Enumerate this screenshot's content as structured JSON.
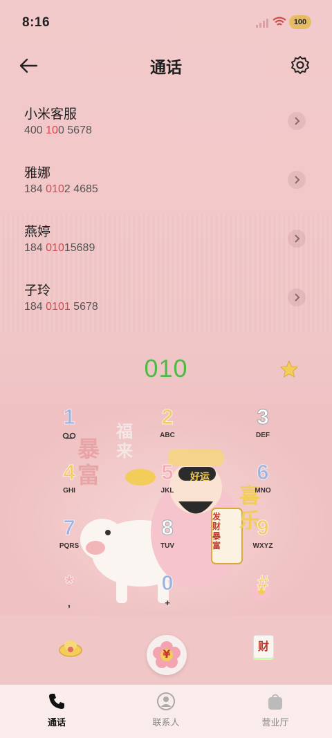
{
  "status": {
    "time": "8:16",
    "battery": "100"
  },
  "header": {
    "title": "通话"
  },
  "recent": [
    {
      "name": "小米客服",
      "num_pre": "400 ",
      "num_hl": "10",
      "num_post": "0 5678"
    },
    {
      "name": "雅娜",
      "num_pre": "184 ",
      "num_hl": "010",
      "num_post": "2 4685"
    },
    {
      "name": "燕婷",
      "num_pre": "184 ",
      "num_hl": "010",
      "num_post": "15689"
    },
    {
      "name": "子玲",
      "num_pre": "184 ",
      "num_hl": "0101",
      "num_post": " 5678"
    }
  ],
  "dialer": {
    "entered": "010",
    "keys": [
      {
        "num": "1",
        "letters": "",
        "color": "#9db1e0"
      },
      {
        "num": "2",
        "letters": "ABC",
        "color": "#f2cc6a"
      },
      {
        "num": "3",
        "letters": "DEF",
        "color": "#ffffff"
      },
      {
        "num": "4",
        "letters": "GHI",
        "color": "#f2cc6a"
      },
      {
        "num": "5",
        "letters": "JKL",
        "color": "#f2a9b2"
      },
      {
        "num": "6",
        "letters": "MNO",
        "color": "#9db1e0"
      },
      {
        "num": "7",
        "letters": "PQRS",
        "color": "#9db1e0"
      },
      {
        "num": "8",
        "letters": "TUV",
        "color": "#ffffff"
      },
      {
        "num": "9",
        "letters": "WXYZ",
        "color": "#f2cc6a"
      },
      {
        "num": "*",
        "letters": ",",
        "color": "#f2a9b2"
      },
      {
        "num": "0",
        "letters": "+",
        "color": "#9db1e0"
      },
      {
        "num": "#",
        "letters": "",
        "color": "#f2cc6a"
      }
    ],
    "call_symbol": "¥",
    "right_action": "财"
  },
  "art_text": {
    "top": "福来",
    "left": "暴富",
    "right": "喜乐",
    "badge": "好运",
    "scroll": "发财暴富"
  },
  "nav": [
    {
      "label": "通话",
      "icon": "phone-icon",
      "active": true
    },
    {
      "label": "联系人",
      "icon": "contact-icon",
      "active": false
    },
    {
      "label": "营业厅",
      "icon": "shop-bag-icon",
      "active": false
    }
  ],
  "colors": {
    "accent_green": "#4cbb45",
    "highlight_red": "#d6474c",
    "background": "#f1c6c7"
  }
}
